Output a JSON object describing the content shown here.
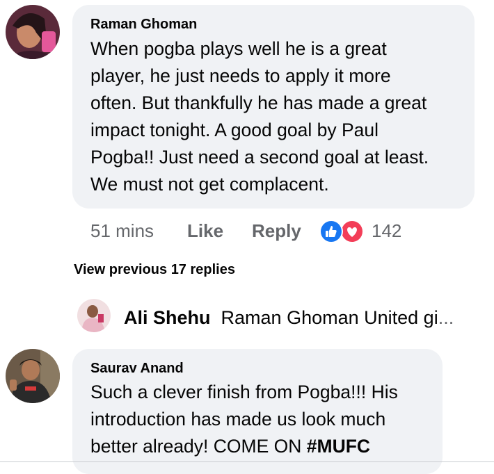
{
  "comments": [
    {
      "author": "Raman Ghoman",
      "text": "When pogba plays well he is a great\nplayer, he just needs to apply it more\noften. But thankfully he has made a great\nimpact tonight. A good goal by Paul\nPogba!! Just need a second goal at least.\nWe must not get complacent.",
      "timestamp": "51 mins",
      "like_label": "Like",
      "reply_label": "Reply",
      "reaction_count": "142",
      "reactions": [
        "like-icon",
        "love-icon"
      ]
    },
    {
      "author": "Saurav Anand",
      "text_main": "Such a clever finish from Pogba!!! His\nintroduction has made us look much\nbetter already! COME ON ",
      "hashtag": "#MUFC"
    }
  ],
  "view_previous_replies": "View previous 17 replies",
  "reply_preview": {
    "author": "Ali Shehu",
    "text": "Raman Ghoman United gi",
    "ellipsis": "..."
  },
  "colors": {
    "bubble": "#f0f2f5",
    "secondary_text": "#65676b",
    "like_blue": "#1877f2",
    "love_red": "#f33e58"
  }
}
